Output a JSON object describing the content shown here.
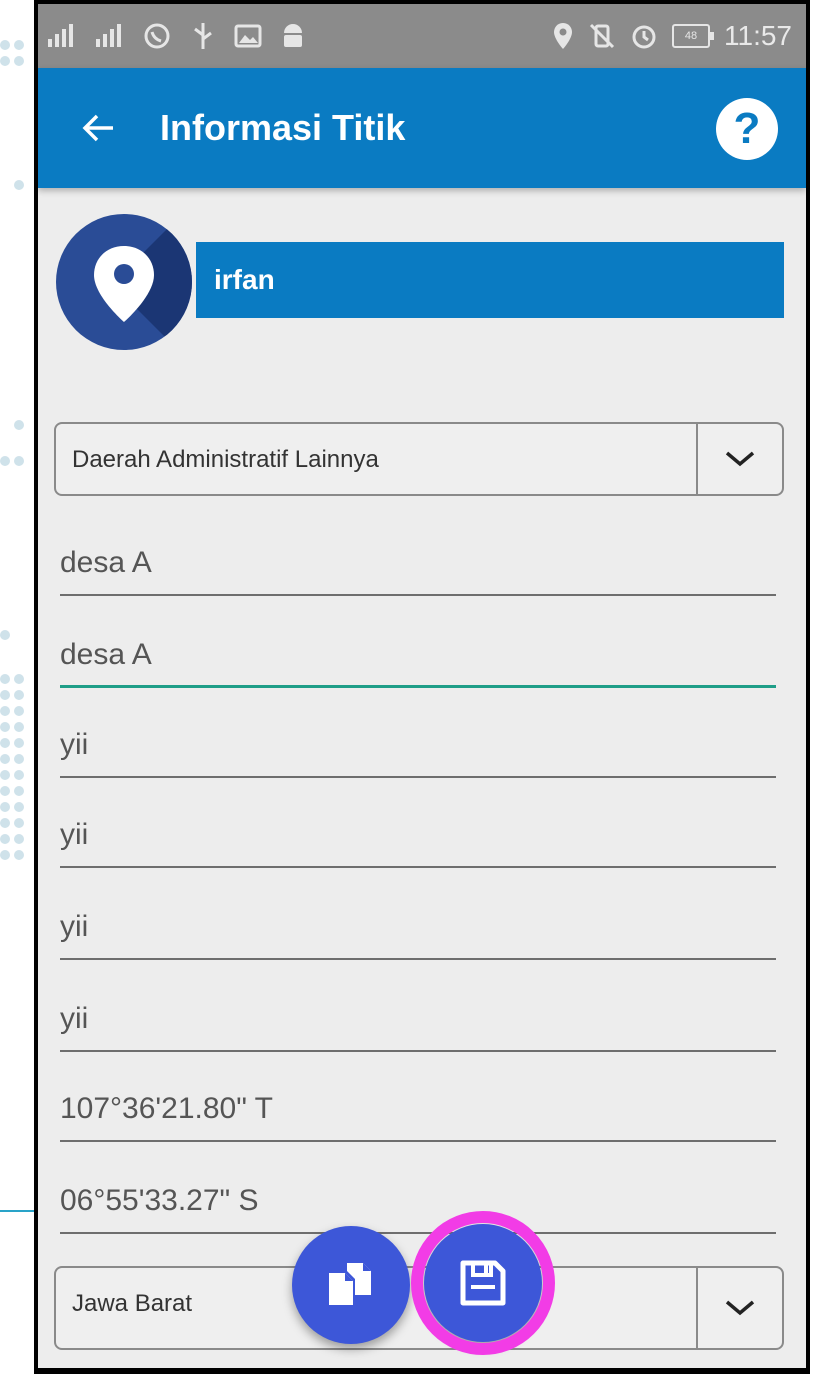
{
  "status_bar": {
    "time": "11:57",
    "battery": "48"
  },
  "app_bar": {
    "title": "Informasi Titik",
    "help_icon": "help-icon"
  },
  "point": {
    "name": "irfan"
  },
  "admin_area_select": {
    "selected": "Daerah Administratif Lainnya"
  },
  "fields": [
    {
      "value": "desa A",
      "focused": false
    },
    {
      "value": "desa A",
      "focused": true
    },
    {
      "value": "yii",
      "focused": false
    },
    {
      "value": "yii",
      "focused": false
    },
    {
      "value": "yii",
      "focused": false
    },
    {
      "value": "yii",
      "focused": false
    },
    {
      "value": "107°36'21.80\"  T",
      "focused": false
    },
    {
      "value": "06°55'33.27\"  S",
      "focused": false
    }
  ],
  "province_select": {
    "selected": "Jawa Barat"
  },
  "fab": {
    "copy_icon": "copy-icon",
    "save_icon": "save-icon"
  },
  "colors": {
    "app_bar": "#0a7bc2",
    "fab": "#3d57d8",
    "focus_underline": "#1f9e88",
    "highlight": "#f23ce6"
  }
}
